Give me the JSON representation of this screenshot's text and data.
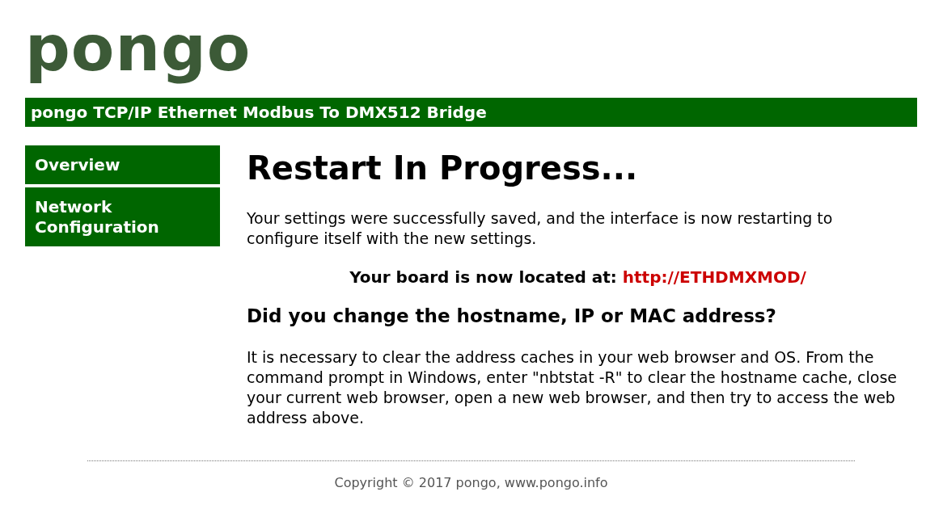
{
  "logo": "pongo",
  "banner": {
    "title": "pongo TCP/IP Ethernet Modbus To DMX512 Bridge"
  },
  "sidebar": {
    "items": [
      {
        "label": "Overview"
      },
      {
        "label": "Network Configuration"
      }
    ]
  },
  "main": {
    "heading": "Restart In Progress...",
    "intro": "Your settings were successfully saved, and the interface is now restarting to configure itself with the new settings.",
    "location": {
      "label": "Your board is now located at:",
      "link": "http://ETHDMXMOD/"
    },
    "subheading": "Did you change the hostname, IP or MAC address?",
    "advice": "It is necessary to clear the address caches in your web browser and OS. From the command prompt in Windows, enter \"nbtstat -R\" to clear the hostname cache, close your current web browser, open a new web browser, and then try to access the web address above."
  },
  "footer": {
    "copyright": "Copyright © 2017 pongo, www.pongo.info"
  }
}
